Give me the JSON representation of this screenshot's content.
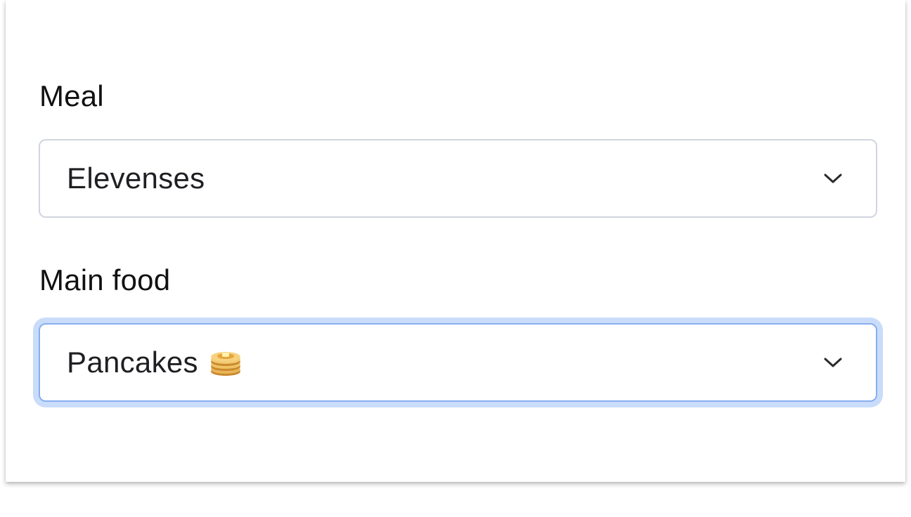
{
  "form": {
    "meal": {
      "label": "Meal",
      "value": "Elevenses"
    },
    "main_food": {
      "label": "Main food",
      "value": "Pancakes",
      "value_icon": "pancakes-icon"
    }
  },
  "icons": {
    "chevron": "chevron-down-icon"
  },
  "colors": {
    "focus_border": "#86aef0",
    "focus_ring": "#c9dcfa",
    "default_border": "#d0d5dd",
    "text": "#1f1f23"
  }
}
